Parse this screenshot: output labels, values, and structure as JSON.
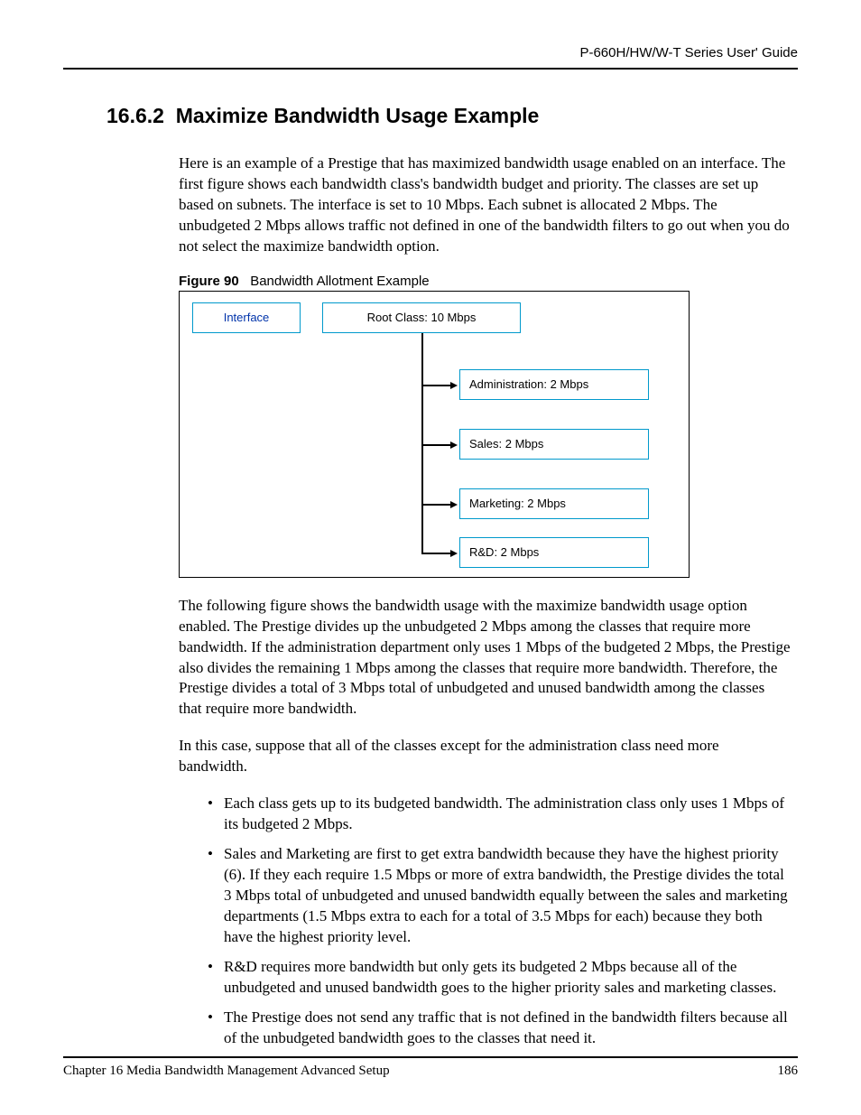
{
  "header": {
    "guide_title": "P-660H/HW/W-T Series User' Guide"
  },
  "section": {
    "number": "16.6.2",
    "title": "Maximize Bandwidth Usage Example"
  },
  "paragraphs": {
    "intro": "Here is an example of a Prestige that has maximized bandwidth usage enabled on an interface. The first figure shows each bandwidth class's bandwidth budget and priority. The classes are set up based on subnets. The interface is set to 10 Mbps. Each subnet is allocated 2 Mbps. The unbudgeted 2 Mbps allows traffic not defined in one of the bandwidth filters to go out when you do not select the maximize bandwidth option.",
    "after_figure": "The following figure shows the bandwidth usage with the maximize bandwidth usage option enabled. The Prestige divides up the unbudgeted 2 Mbps among the classes that require more bandwidth. If the administration department only uses 1 Mbps of the budgeted 2 Mbps, the Prestige also divides the remaining 1 Mbps among the classes that require more bandwidth. Therefore, the Prestige divides a total of 3 Mbps total of unbudgeted and unused bandwidth among the classes that require more bandwidth.",
    "suppose": "In this case, suppose that all of the classes except for the administration class need more bandwidth."
  },
  "figure": {
    "label": "Figure 90",
    "caption": "Bandwidth Allotment Example",
    "interface_box": "Interface",
    "root_box": "Root Class: 10 Mbps",
    "leaves": {
      "admin": "Administration: 2 Mbps",
      "sales": "Sales: 2 Mbps",
      "marketing": "Marketing: 2 Mbps",
      "rnd": "R&D: 2 Mbps"
    }
  },
  "bullets": [
    "Each class gets up to its budgeted bandwidth. The administration class only uses 1 Mbps of its budgeted 2 Mbps.",
    "Sales and Marketing are first to get extra bandwidth because they have the highest priority (6). If they each require 1.5 Mbps or more of extra bandwidth, the Prestige divides the total 3 Mbps total of unbudgeted and unused bandwidth equally between the sales and marketing departments (1.5 Mbps extra to each for a total of 3.5 Mbps for each) because they both have the highest priority level.",
    "R&D requires more bandwidth but only gets its budgeted 2 Mbps because all of the unbudgeted and unused bandwidth goes to the higher priority sales and marketing classes.",
    "The Prestige does not send any traffic that is not defined in the bandwidth filters because all of the unbudgeted bandwidth goes to the classes that need it."
  ],
  "footer": {
    "chapter": "Chapter 16 Media Bandwidth Management Advanced Setup",
    "page": "186"
  },
  "chart_data": {
    "type": "tree",
    "root": {
      "label": "Root Class",
      "bandwidth_mbps": 10
    },
    "interface_bandwidth_mbps": 10,
    "unbudgeted_mbps": 2,
    "children": [
      {
        "label": "Administration",
        "bandwidth_mbps": 2
      },
      {
        "label": "Sales",
        "bandwidth_mbps": 2
      },
      {
        "label": "Marketing",
        "bandwidth_mbps": 2
      },
      {
        "label": "R&D",
        "bandwidth_mbps": 2
      }
    ]
  }
}
